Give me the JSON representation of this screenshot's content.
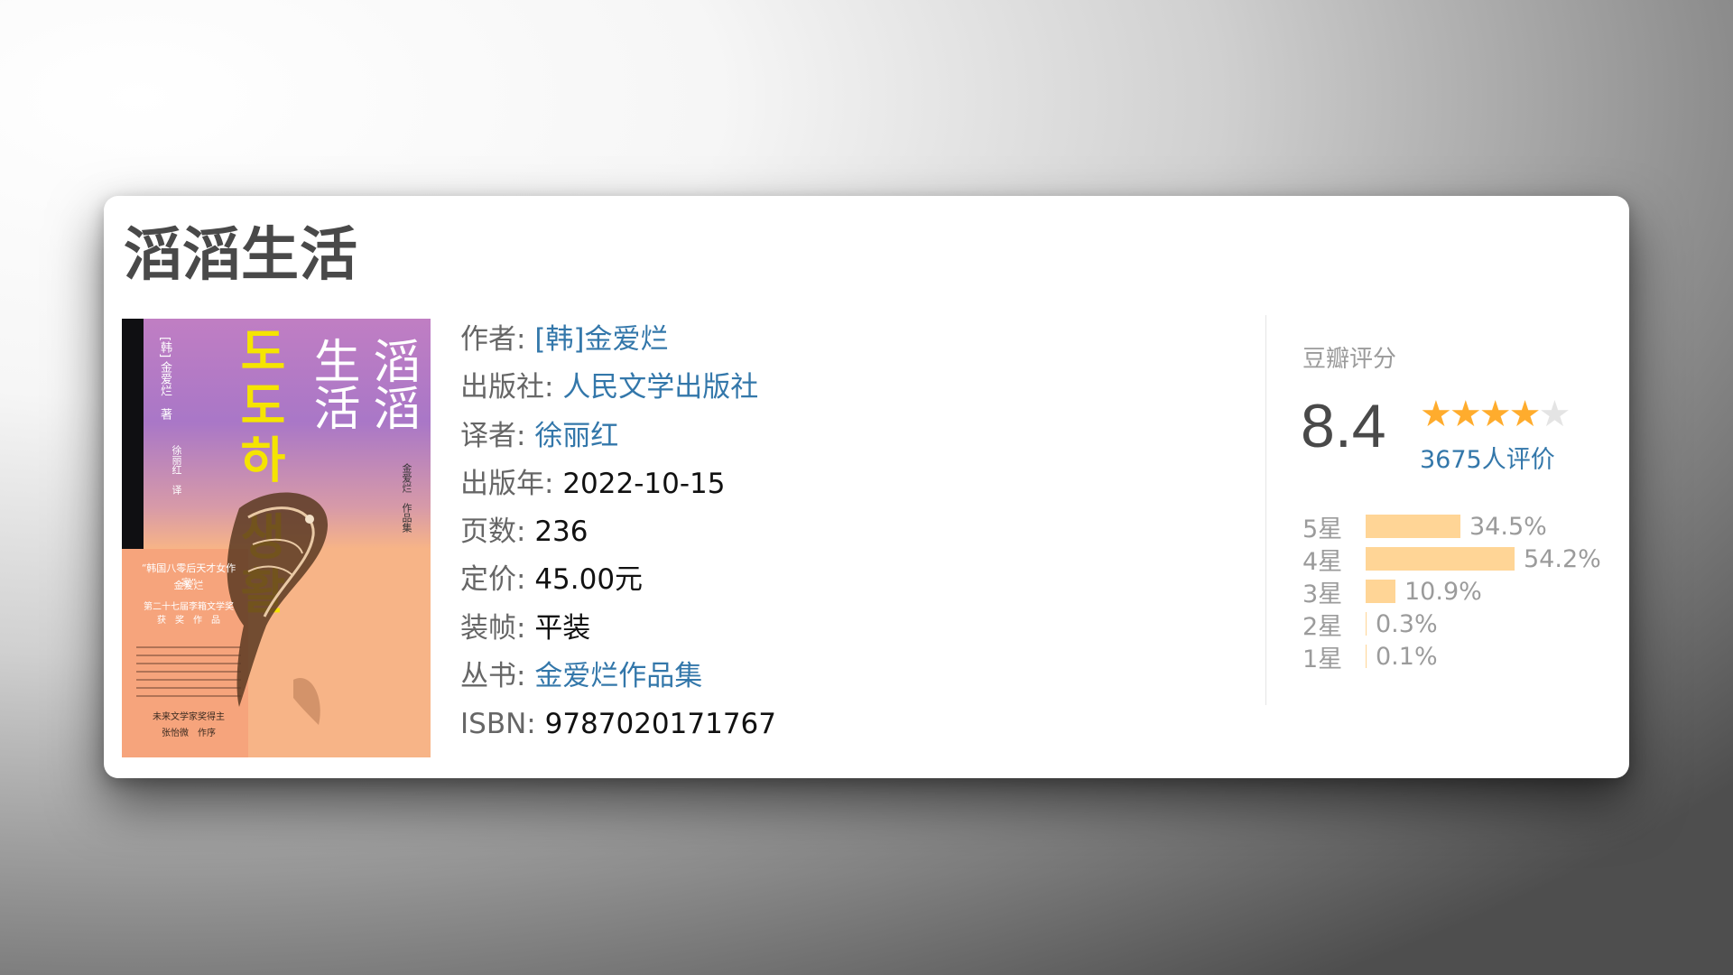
{
  "book": {
    "title": "滔滔生活"
  },
  "cover": {
    "title_line1": "滔滔",
    "title_line2": "生活",
    "author": "[韩] 金爱烂　著",
    "translator": "徐丽红　译",
    "collection": "金爱烂　作品集",
    "korean_title": "도도하 생활",
    "blurb_head": "“韩国八零后天才女作家”",
    "blurb_name": "金爱烂",
    "award_line1": "第二十七届李箱文学奖",
    "award_line2": "获　奖　作　品",
    "bottom_line1": "未来文学家奖得主",
    "bottom_line2": "张怡微　作序"
  },
  "info": {
    "author_label": "作者:",
    "author_value": "[韩]金爱烂",
    "publisher_label": "出版社:",
    "publisher_value": "人民文学出版社",
    "translator_label": "译者:",
    "translator_value": "徐丽红",
    "pubyear_label": "出版年:",
    "pubyear_value": "2022-10-15",
    "pages_label": "页数:",
    "pages_value": "236",
    "price_label": "定价:",
    "price_value": "45.00元",
    "binding_label": "装帧:",
    "binding_value": "平装",
    "series_label": "丛书:",
    "series_value": "金爱烂作品集",
    "isbn_label": "ISBN:",
    "isbn_value": "9787020171767"
  },
  "rating": {
    "title": "豆瓣评分",
    "score": "8.4",
    "stars_filled": 4,
    "stars_total": 5,
    "votes": "3675人评价",
    "star_color": "#ffac2d",
    "bar_color": "#ffd596",
    "distribution": [
      {
        "label": "5星",
        "percent": "34.5%",
        "value": 34.5
      },
      {
        "label": "4星",
        "percent": "54.2%",
        "value": 54.2
      },
      {
        "label": "3星",
        "percent": "10.9%",
        "value": 10.9
      },
      {
        "label": "2星",
        "percent": "0.3%",
        "value": 0.3
      },
      {
        "label": "1星",
        "percent": "0.1%",
        "value": 0.1
      }
    ]
  },
  "colors": {
    "link": "#3377aa",
    "title": "#494949",
    "cover_orange": "#f7b487",
    "cover_purple": "#a977c7"
  }
}
